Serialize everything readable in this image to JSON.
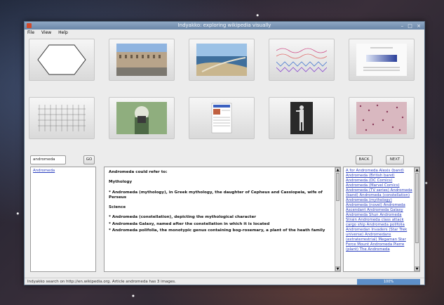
{
  "window": {
    "title": "Indyakko: exploring wikipedia visually"
  },
  "menu": [
    "File",
    "View",
    "Help"
  ],
  "thumbnails": [
    {
      "name": "hexagon"
    },
    {
      "name": "building-square"
    },
    {
      "name": "coastline"
    },
    {
      "name": "wave-chart"
    },
    {
      "name": "data-diagram"
    },
    {
      "name": "star-chart"
    },
    {
      "name": "banknote-portrait"
    },
    {
      "name": "webpage"
    },
    {
      "name": "statue"
    },
    {
      "name": "texture"
    }
  ],
  "search": {
    "value": "andromeda",
    "go_label": "GO"
  },
  "nav": {
    "back_label": "BACK",
    "next_label": "NEXT"
  },
  "left_list": [
    "Andromeda"
  ],
  "article": [
    "Andromeda could refer to:",
    "Mythology",
    "* Andromeda (mythology), in Greek mythology, the daughter of Cepheus and Cassiopeia, wife of Perseus",
    "Science",
    "* Andromeda (constellation), depicting the mythological character",
    "* Andromeda Galaxy, named after the constellation in which it is located",
    "* Andromeda polifolia, the monotypic genus containing bog-rosemary, a plant of the heath family"
  ],
  "related_links": "A for Andromeda Alexis (band) Andromeda (British band) Andromeda (DC Comics) Andromeda (Marvel Comics) Andromeda (TV series) Andromeda (band) Andromeda (constellation) Andromeda (mythology) Andromeda (novel) Andromeda Ascendant Andromeda Galaxy Andromeda Shun Andromeda Strain Andromeda class attack cargo ship Andromeda polifolia Andromedan Invaders (Star Trek universe) Andromedans (extraterrestrial) Megaman Star Force Mount Andromeda Pierre (plant) The Andromeda",
  "status": {
    "text": "Indyakko search on http://en.wikipedia.org. Article andromeda has 3 images.",
    "progress_label": "100%"
  },
  "accent_color": "#5d8fc9"
}
